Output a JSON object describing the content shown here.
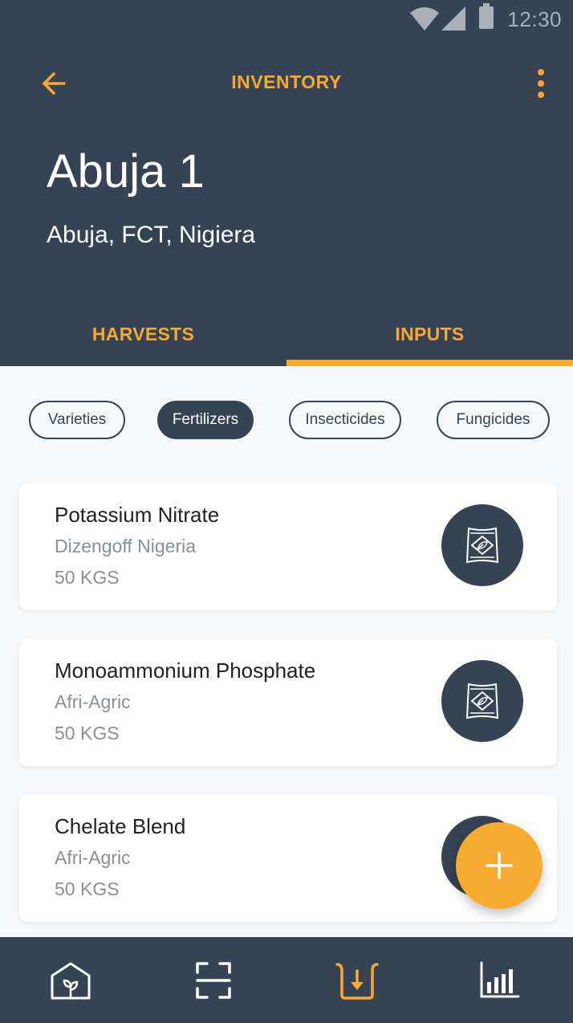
{
  "status_bar": {
    "time": "12:30"
  },
  "header": {
    "title": "INVENTORY",
    "farm_name": "Abuja 1",
    "farm_location": "Abuja, FCT, Nigiera"
  },
  "tabs": [
    {
      "label": "HARVESTS",
      "active": false
    },
    {
      "label": "INPUTS",
      "active": true
    }
  ],
  "filters": [
    {
      "label": "Varieties",
      "active": false
    },
    {
      "label": "Fertilizers",
      "active": true
    },
    {
      "label": "Insecticides",
      "active": false
    },
    {
      "label": "Fungicides",
      "active": false
    }
  ],
  "inventory_items": [
    {
      "name": "Potassium Nitrate",
      "supplier": "Dizengoff Nigeria",
      "quantity": "50 KGS",
      "icon": "fertilizer-bag-icon"
    },
    {
      "name": "Monoammonium Phosphate",
      "supplier": "Afri-Agric",
      "quantity": "50 KGS",
      "icon": "fertilizer-bag-icon"
    },
    {
      "name": "Chelate Blend",
      "supplier": "Afri-Agric",
      "quantity": "50 KGS",
      "icon": "fertilizer-bag-icon"
    }
  ],
  "fab": {
    "icon": "plus-icon"
  },
  "bottom_nav": [
    {
      "icon": "greenhouse-icon",
      "active": false
    },
    {
      "icon": "scan-icon",
      "active": false
    },
    {
      "icon": "inventory-icon",
      "active": true
    },
    {
      "icon": "analytics-icon",
      "active": false
    }
  ],
  "colors": {
    "primary_dark": "#364354",
    "accent": "#f7a92f",
    "background": "#f7f8fa",
    "card": "#ffffff",
    "text_secondary": "#8a8f97"
  }
}
